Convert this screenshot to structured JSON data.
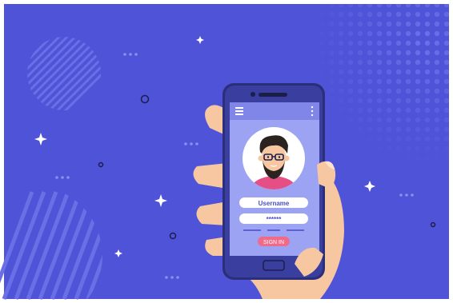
{
  "login_form": {
    "username_placeholder": "Username",
    "password_mask": "******",
    "sign_in_label": "SIGN IN"
  },
  "colors": {
    "background": "#4f53d8",
    "phone_body": "#3a3e9e",
    "screen": "#9ca3f2",
    "screen_header": "#7f86e8",
    "accent_button": "#f06a8a",
    "skin": "#f6c7a1",
    "hair": "#2a2320",
    "shirt": "#e64f86"
  },
  "icons": {
    "menu": "hamburger-menu-icon",
    "more": "vertical-dots-icon",
    "avatar": "user-avatar",
    "front_camera": "camera-icon"
  }
}
